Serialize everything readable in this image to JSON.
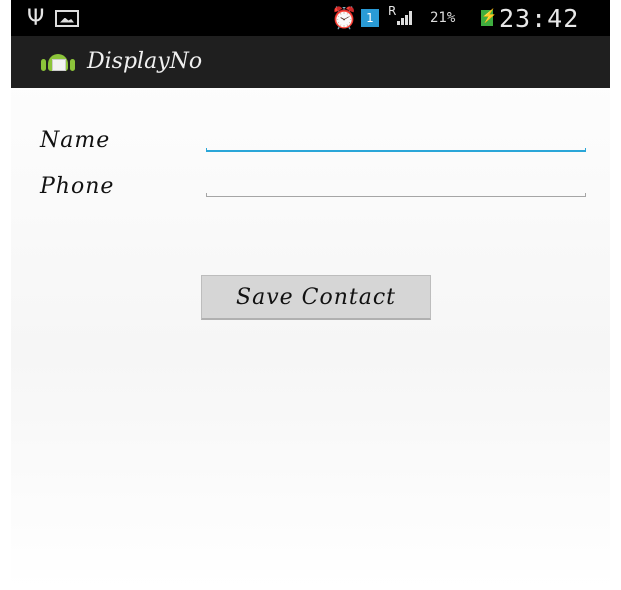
{
  "status_bar": {
    "icons": [
      "usb-icon",
      "gallery-icon",
      "alarm-icon",
      "notification-icon",
      "signal-icon",
      "battery-charging-icon"
    ],
    "notification_count": "1",
    "roaming_indicator": "R",
    "battery_percent": "21%",
    "time": "23:42",
    "colors": {
      "background": "#000000",
      "notification": "#2a9bd6",
      "battery": "#3fae3f"
    }
  },
  "action_bar": {
    "icon": "android-app-icon",
    "title": "DisplayNo",
    "background": "#1f1f1f"
  },
  "form": {
    "name_label": "Name",
    "name_value": "",
    "phone_label": "Phone",
    "phone_value": "",
    "focused_field_color": "#2aa6d8",
    "save_button_label": "Save Contact"
  }
}
